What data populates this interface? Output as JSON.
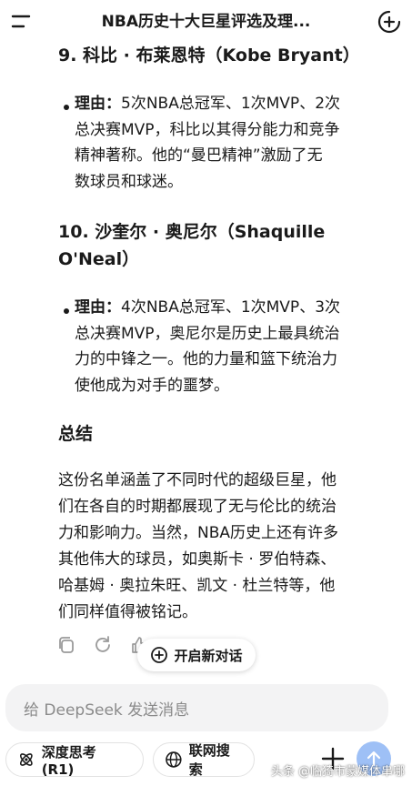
{
  "header": {
    "title": "NBA历史十大巨星评选及理...",
    "menu_icon": "hamburger-icon",
    "new_chat_icon": "plus-circle-icon"
  },
  "content": {
    "kobe_heading": "9. 科比 · 布莱恩特（Kobe Bryant）",
    "kobe_bullet_label": "理由：",
    "kobe_bullet_line1_rest": "5次NBA总冠军、1次MVP、2次",
    "kobe_bullet_line2": "总决赛MVP，科比以其得分能力和竞争",
    "kobe_bullet_line3": "精神著称。他的“曼巴精神”激励了无",
    "kobe_bullet_line4": "数球员和球迷。",
    "shaq_heading_line1": "10. 沙奎尔 · 奥尼尔（Shaquille",
    "shaq_heading_line2": "O'Neal）",
    "shaq_bullet_label": "理由：",
    "shaq_bullet_line1_rest": "4次NBA总冠军、1次MVP、3次",
    "shaq_bullet_line2": "总决赛MVP，奥尼尔是历史上最具统治",
    "shaq_bullet_line3": "力的中锋之一。他的力量和篮下统治力",
    "shaq_bullet_line4": "使他成为对手的噩梦。",
    "summary_heading": "总结",
    "summary_lines": [
      "这份名单涵盖了不同时代的超级巨星，他",
      "们在各自的时期都展现了无与伦比的统治",
      "力和影响力。当然，NBA历史上还有许多",
      "其他伟大的球员，如奥斯卡 · 罗伯特森、",
      "哈基姆 · 奥拉朱旺、凯文 · 杜兰特等，他",
      "们同样值得被铭记。"
    ]
  },
  "actions": {
    "copy_icon": "copy-icon",
    "regenerate_icon": "refresh-icon",
    "like_icon": "thumbs-up-icon",
    "new_chat_label": "开启新对话"
  },
  "composer": {
    "placeholder": "给 DeepSeek 发送消息",
    "deepthink_label": "深度思考 (R1)",
    "search_label": "联网搜索",
    "attach_icon": "plus-icon",
    "send_icon": "arrow-up-icon"
  },
  "watermark": "头条 @临猗市蒙媒体串哪",
  "colors": {
    "text": "#1a1a1a",
    "send_button": "#9ec0f6",
    "input_bg": "#f3f3f4"
  }
}
